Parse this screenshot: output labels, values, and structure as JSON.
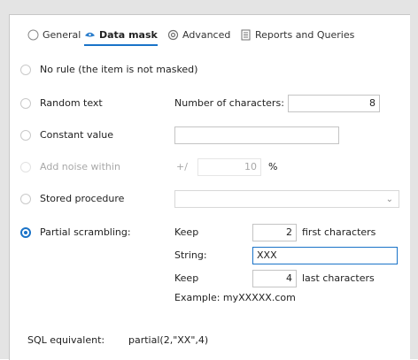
{
  "tabs": [
    {
      "label": "General",
      "icon": "radio-icon",
      "active": false
    },
    {
      "label": "Data mask",
      "icon": "mask-icon",
      "active": true
    },
    {
      "label": "Advanced",
      "icon": "gear-icon",
      "active": false
    },
    {
      "label": "Reports and Queries",
      "icon": "report-icon",
      "active": false
    }
  ],
  "options": {
    "no_rule": {
      "label": "No rule (the item is not masked)"
    },
    "random_text": {
      "label": "Random text",
      "field_label": "Number of characters:",
      "value": "8"
    },
    "constant_value": {
      "label": "Constant value",
      "value": ""
    },
    "add_noise": {
      "label": "Add noise within",
      "prefix": "+/",
      "value": "10",
      "unit": "%"
    },
    "stored_procedure": {
      "label": "Stored procedure",
      "value": ""
    },
    "partial_scrambling": {
      "label": "Partial scrambling:",
      "keep_label": "Keep",
      "first_value": "2",
      "first_suffix": "first characters",
      "string_label": "String:",
      "string_value": "XXX",
      "keep2_label": "Keep",
      "last_value": "4",
      "last_suffix": "last characters",
      "example": "Example: myXXXXX.com"
    }
  },
  "sql": {
    "label": "SQL equivalent:",
    "value": "partial(2,\"XX\",4)"
  },
  "colors": {
    "accent": "#1a73c8"
  }
}
